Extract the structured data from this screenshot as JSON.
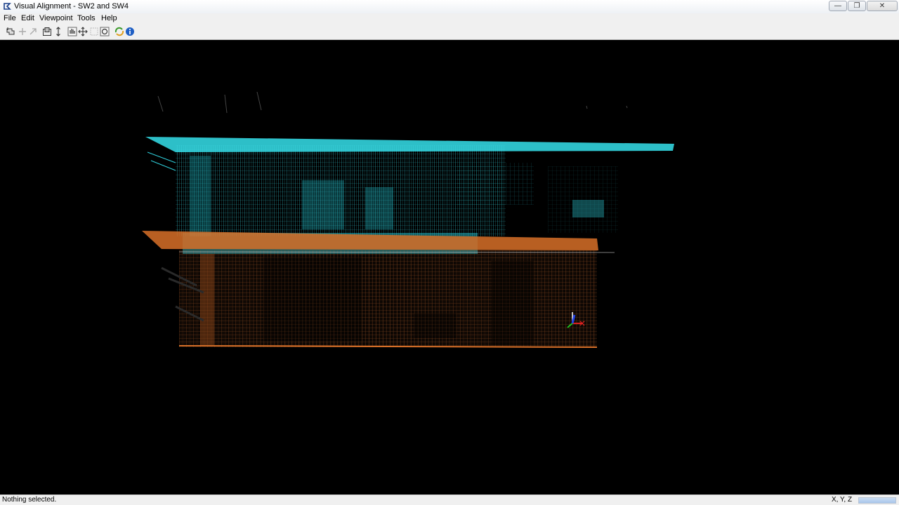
{
  "window": {
    "title": "Visual Alignment - SW2 and SW4",
    "app_icon": "app-logo-icon",
    "controls": {
      "minimize": "minimize-icon",
      "restore": "restore-icon",
      "close": "close-icon"
    }
  },
  "menu": {
    "items": [
      {
        "label": "File"
      },
      {
        "label": "Edit"
      },
      {
        "label": "Viewpoint"
      },
      {
        "label": "Tools"
      },
      {
        "label": "Help"
      }
    ]
  },
  "toolbar": {
    "tools": [
      {
        "icon": "select-tool-icon"
      },
      {
        "icon": "add-point-icon"
      },
      {
        "icon": "remove-point-icon"
      },
      {
        "icon": "fit-view-icon"
      },
      {
        "icon": "vertical-axis-icon"
      },
      {
        "icon": "pan-hand-icon"
      },
      {
        "icon": "move-arrows-icon"
      },
      {
        "icon": "zoom-region-icon"
      },
      {
        "icon": "rotate-view-icon"
      },
      {
        "icon": "refresh-alignment-icon"
      },
      {
        "icon": "info-icon"
      }
    ]
  },
  "viewport": {
    "background": "#000000",
    "clouds": [
      {
        "name": "cyan-scan",
        "color": "#33d6e0"
      },
      {
        "name": "orange-scan",
        "color": "#d06a2a"
      }
    ],
    "axis_gizmo": {
      "x_color": "#e02020",
      "y_color": "#20c020",
      "z_color": "#2040e0"
    }
  },
  "status": {
    "message": "Nothing selected.",
    "coordinates_label": "X, Y, Z",
    "progress": 1.0
  }
}
